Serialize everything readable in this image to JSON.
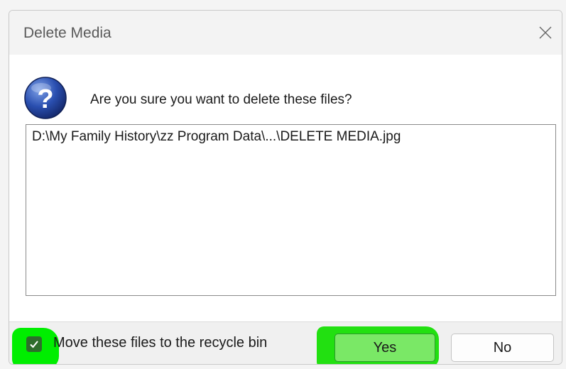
{
  "window": {
    "title": "Delete Media"
  },
  "icons": {
    "close": "close-icon",
    "question": "question-icon",
    "check": "checkmark-icon"
  },
  "dialog": {
    "message": "Are you sure you want to delete these files?",
    "files": [
      "D:\\My Family History\\zz Program Data\\...\\DELETE MEDIA.jpg"
    ]
  },
  "options": {
    "recycle_label": "Move these files to the recycle bin",
    "recycle_checked": true
  },
  "buttons": {
    "yes": "Yes",
    "no": "No"
  },
  "colors": {
    "highlight": "#22e011",
    "checkbox_fill": "#2e6d2c",
    "question_icon": "#1f3f94"
  }
}
